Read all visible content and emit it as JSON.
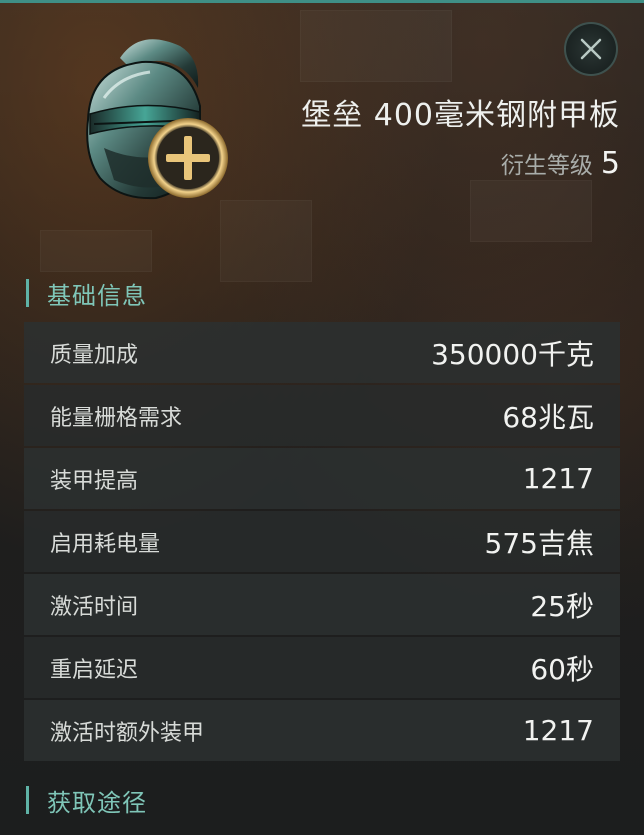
{
  "item": {
    "name": "堡垒 400毫米钢附甲板",
    "level_label": "衍生等级",
    "level_value": "5",
    "icon": "armor-helmet-plus-icon"
  },
  "close": {
    "icon": "close-icon"
  },
  "sections": {
    "basic_info": "基础信息",
    "acquire": "获取途径"
  },
  "stats": [
    {
      "label": "质量加成",
      "value": "350000千克"
    },
    {
      "label": "能量栅格需求",
      "value": "68兆瓦"
    },
    {
      "label": "装甲提高",
      "value": "1217"
    },
    {
      "label": "启用耗电量",
      "value": "575吉焦"
    },
    {
      "label": "激活时间",
      "value": "25秒"
    },
    {
      "label": "重启延迟",
      "value": "60秒"
    },
    {
      "label": "激活时额外装甲",
      "value": "1217"
    }
  ],
  "colors": {
    "accent": "#5fb3a7",
    "section_text": "#7fc6b8",
    "gold": "#d9b56a"
  }
}
